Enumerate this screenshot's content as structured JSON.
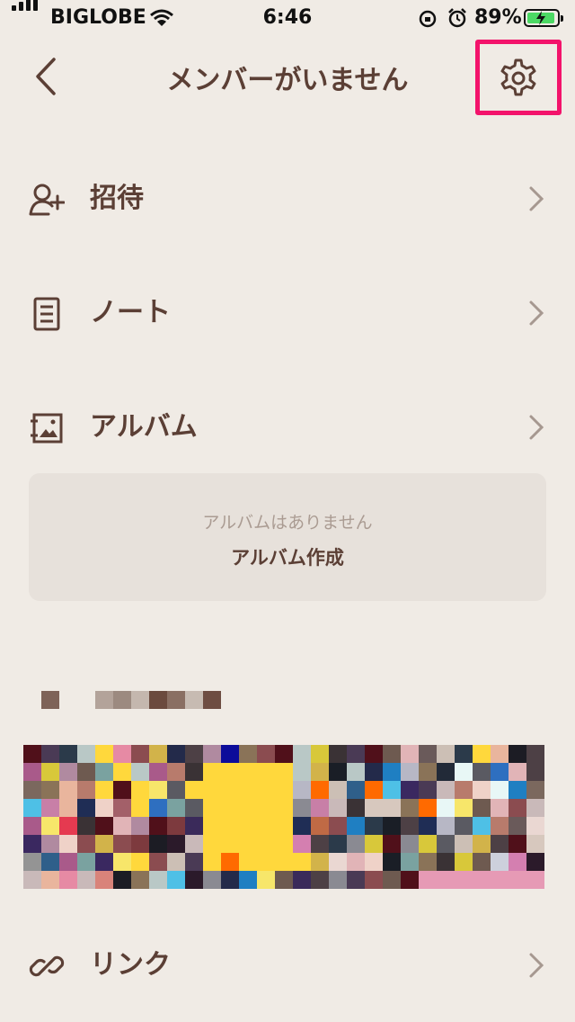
{
  "status_bar": {
    "carrier": "BIGLOBE",
    "time": "6:46",
    "battery": "89%",
    "battery_level": 0.89
  },
  "header": {
    "title": "メンバーがいません",
    "back_icon": "chevron-left-icon",
    "settings_icon": "gear-icon",
    "highlight_color": "#f3136b"
  },
  "menu": {
    "invite": {
      "label": "招待",
      "icon": "add-person-icon"
    },
    "note": {
      "label": "ノート",
      "icon": "note-icon"
    },
    "album": {
      "label": "アルバム",
      "icon": "album-icon"
    },
    "link": {
      "label": "リンク",
      "icon": "link-icon"
    }
  },
  "album_empty": {
    "message": "アルバムはありません",
    "create_label": "アルバム作成"
  },
  "member_preview": {
    "note": "pixelated member names and avatars (obscured)"
  },
  "colors": {
    "background": "#f0ebe5",
    "text": "#5b3f35",
    "card": "#e7e1db",
    "chevron": "#a69890"
  }
}
